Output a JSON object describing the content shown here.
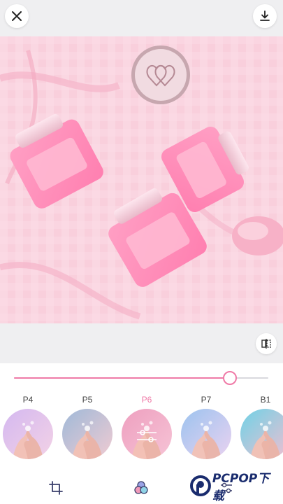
{
  "toolbar": {
    "close_icon": "close-icon",
    "download_icon": "download-icon",
    "compare_icon": "split-compare-icon"
  },
  "slider": {
    "value": 0.85,
    "accent": "#ef7aa7",
    "track": "#d9d9de"
  },
  "filters": [
    {
      "label": "P4",
      "selected": false,
      "tint": [
        "#d4b8f0",
        "#f3d2e6"
      ]
    },
    {
      "label": "P5",
      "selected": false,
      "tint": [
        "#9fb9d8",
        "#f0cbd2"
      ]
    },
    {
      "label": "P6",
      "selected": true,
      "tint": [
        "#ee9fbf",
        "#f6c4d6"
      ]
    },
    {
      "label": "P7",
      "selected": false,
      "tint": [
        "#9cc3ef",
        "#ead2f0"
      ]
    },
    {
      "label": "B1",
      "selected": false,
      "tint": [
        "#6fd2e6",
        "#f3bed1"
      ]
    }
  ],
  "bottom_tabs": [
    {
      "icon": "crop-icon"
    },
    {
      "icon": "filter-circles-icon"
    },
    {
      "icon": "adjust-sliders-icon"
    }
  ],
  "watermark": {
    "text": "PCPOP下载"
  }
}
